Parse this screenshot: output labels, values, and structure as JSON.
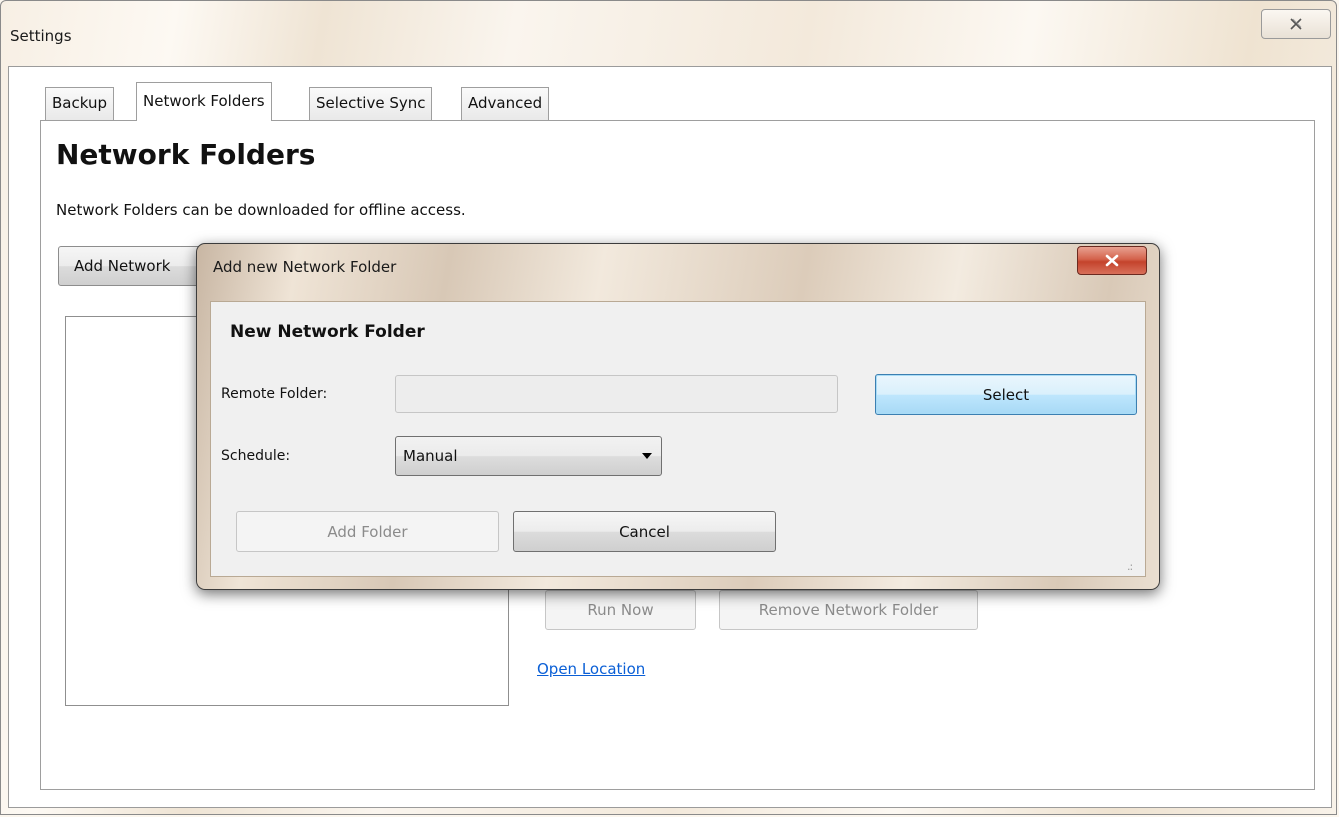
{
  "window": {
    "title": "Settings",
    "close_icon": "close-icon"
  },
  "tabs": [
    {
      "label": "Backup",
      "active": false
    },
    {
      "label": "Network Folders",
      "active": true
    },
    {
      "label": "Selective Sync",
      "active": false
    },
    {
      "label": "Advanced",
      "active": false
    }
  ],
  "page": {
    "heading": "Network Folders",
    "description": "Network Folders can be downloaded for offline access.",
    "add_button_label": "Add Network",
    "run_now_label": "Run Now",
    "remove_label": "Remove Network Folder",
    "open_location_label": "Open Location"
  },
  "dialog": {
    "title": "Add new Network Folder",
    "close_icon": "close-icon",
    "heading": "New Network Folder",
    "remote_folder_label": "Remote Folder:",
    "remote_folder_value": "",
    "select_label": "Select",
    "schedule_label": "Schedule:",
    "schedule_value": "Manual",
    "add_folder_label": "Add Folder",
    "cancel_label": "Cancel"
  },
  "colors": {
    "link": "#0a5fd6",
    "dialog_close": "#c4432c",
    "select_button": "#bee6fd"
  }
}
